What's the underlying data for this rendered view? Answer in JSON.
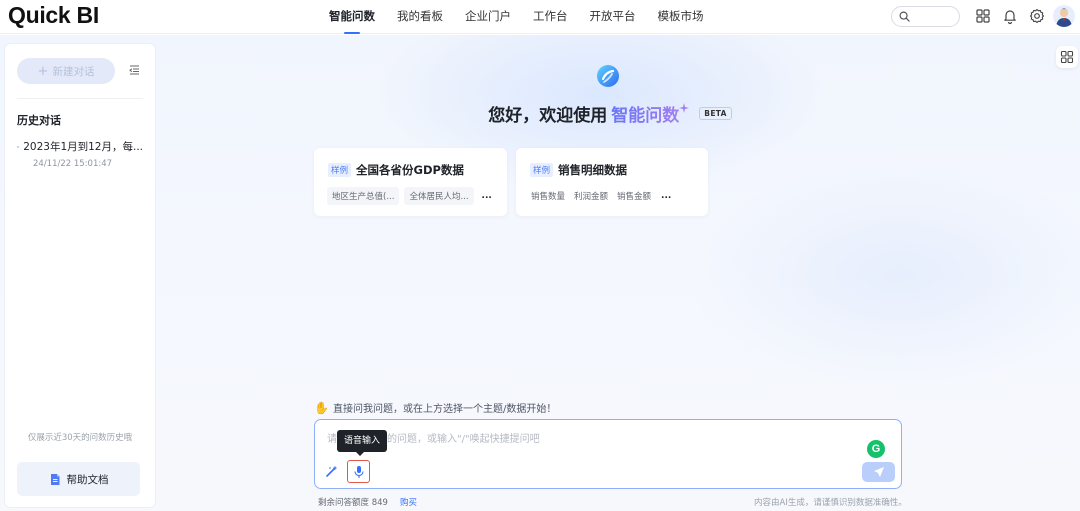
{
  "app": {
    "logo": "Quick BI"
  },
  "nav": {
    "items": [
      {
        "label": "智能问数",
        "active": true
      },
      {
        "label": "我的看板",
        "active": false
      },
      {
        "label": "企业门户",
        "active": false
      },
      {
        "label": "工作台",
        "active": false
      },
      {
        "label": "开放平台",
        "active": false
      },
      {
        "label": "模板市场",
        "active": false
      }
    ],
    "icons": [
      "search-icon",
      "apps-grid-icon",
      "bell-icon",
      "gear-icon",
      "user-avatar"
    ]
  },
  "sidebar": {
    "new_chat_label": "新建对话",
    "history_title": "历史对话",
    "history": [
      {
        "title": "2023年1月到12月，每...",
        "time": "24/11/22 15:01:47"
      }
    ],
    "history_note": "仅展示近30天的问数历史哦",
    "help_label": "帮助文档"
  },
  "hero": {
    "greeting": "您好，欢迎使用",
    "brand": "智能问数",
    "badge": "BETA"
  },
  "cards": [
    {
      "tag": "样例",
      "title": "全国各省份GDP数据",
      "fields": [
        "地区生产总值(...",
        "全体居民人均..."
      ],
      "more": "..."
    },
    {
      "tag": "样例",
      "title": "销售明细数据",
      "fields": [
        "销售数量",
        "利润金额",
        "销售金额"
      ],
      "more": "..."
    }
  ],
  "prompt": {
    "hint": "直接问我问题，或在上方选择一个主题/数据开始！",
    "placeholder": "请输入你想问的问题，或输入\"/\"唤起快捷提问吧",
    "tooltip": "语音输入",
    "grammar_badge": "G"
  },
  "footer": {
    "quota": "剩余问答额度 849",
    "buy": "购买",
    "disclaimer": "内容由AI生成，请谨慎识别数据准确性。"
  },
  "colors": {
    "accent": "#3370ff",
    "brand_gradient_start": "#6a74f4",
    "brand_gradient_end": "#a37ef3",
    "mic_highlight": "#e0584a"
  }
}
